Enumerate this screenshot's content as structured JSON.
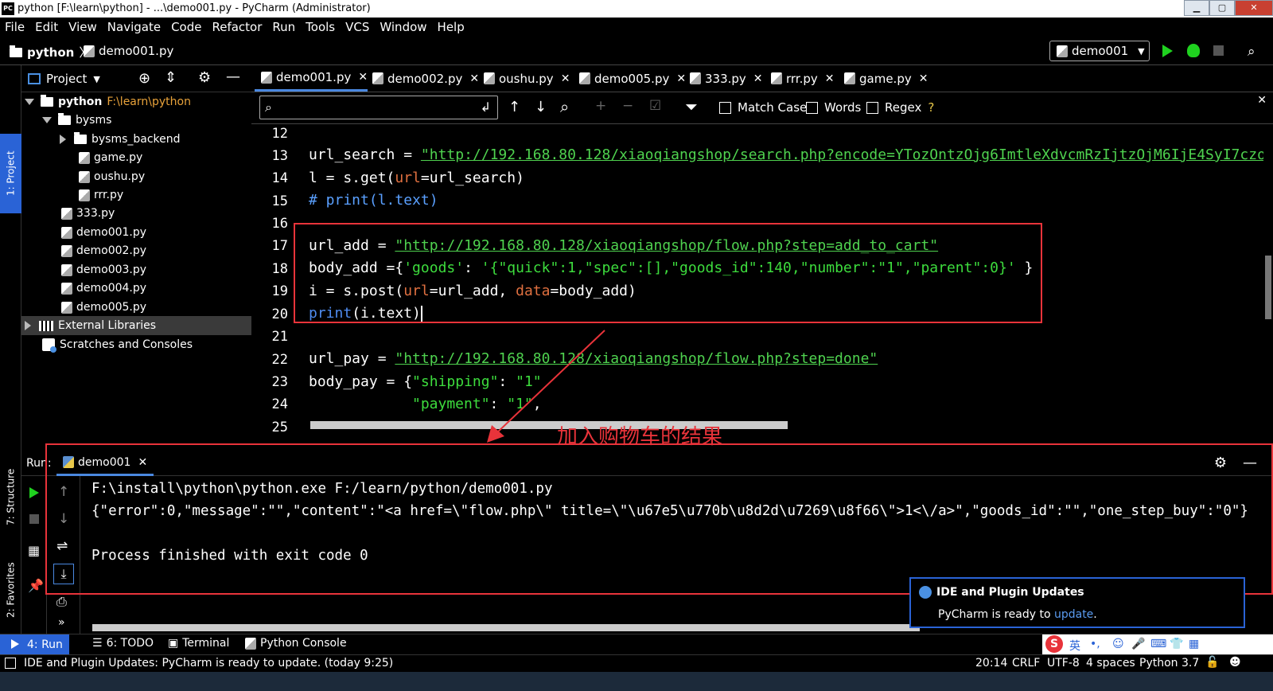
{
  "window": {
    "title": "python [F:\\learn\\python] - ...\\demo001.py - PyCharm (Administrator)",
    "app_icon": "PC"
  },
  "menu": [
    "File",
    "Edit",
    "View",
    "Navigate",
    "Code",
    "Refactor",
    "Run",
    "Tools",
    "VCS",
    "Window",
    "Help"
  ],
  "breadcrumb": {
    "project": "python",
    "file": "demo001.py"
  },
  "run_config": "demo001",
  "project_panel": {
    "title": "Project",
    "root": {
      "name": "python",
      "path": "F:\\learn\\python"
    },
    "items": [
      "bysms",
      "bysms_backend",
      "game.py",
      "oushu.py",
      "rrr.py",
      "333.py",
      "demo001.py",
      "demo002.py",
      "demo003.py",
      "demo004.py",
      "demo005.py"
    ],
    "external": "External Libraries",
    "scratches": "Scratches and Consoles"
  },
  "editor_tabs": [
    "demo001.py",
    "demo002.py",
    "oushu.py",
    "demo005.py",
    "333.py",
    "rrr.py",
    "game.py"
  ],
  "find": {
    "match_case": "Match Case",
    "words": "Words",
    "regex": "Regex",
    "help": "?"
  },
  "code": {
    "line_numbers": [
      "12",
      "13",
      "14",
      "15",
      "16",
      "17",
      "18",
      "19",
      "20",
      "21",
      "22",
      "23",
      "24",
      "25"
    ],
    "l13_var": "url_search",
    "l13_url": "\"http://192.168.80.128/xiaoqiangshop/search.php?encode=YTozOntzOjg6ImtleXdvcmRzIjtzOjM6IjE4SyI7czo",
    "l14_a": "l = s.get(",
    "l14_b": "url",
    "l14_c": "=url_search)",
    "l15": "# print(l.text)",
    "l17_var": "url_add = ",
    "l17_url": "\"http://192.168.80.128/xiaoqiangshop/flow.php?step=add_to_cart\"",
    "l18_a": "body_add ={",
    "l18_b": "'goods'",
    "l18_c": ": ",
    "l18_d": "'{\"quick\":1,\"spec\":[],\"goods_id\":140,\"number\":\"1\",\"parent\":0}'",
    "l18_e": " }",
    "l19_a": "i = s.post(",
    "l19_b": "url",
    "l19_c": "=url_add, ",
    "l19_d": "data",
    "l19_e": "=body_add)",
    "l20_a": "print",
    "l20_b": "(i.text)",
    "l22_var": "url_pay = ",
    "l22_url": "\"http://192.168.80.128/xiaoqiangshop/flow.php?step=done\"",
    "l23_a": "body_pay = {",
    "l23_b": "\"shipping\"",
    "l23_c": ": ",
    "l23_d": "\"1\"",
    "l24_a": "\"payment\"",
    "l24_b": ": ",
    "l24_c": "\"1\"",
    "l24_d": ","
  },
  "annotation": "加入购物车的结果",
  "run_panel": {
    "label": "Run:",
    "tab": "demo001",
    "lines": [
      "F:\\install\\python\\python.exe F:/learn/python/demo001.py",
      "{\"error\":0,\"message\":\"\",\"content\":\"<a href=\\\"flow.php\\\" title=\\\"\\u67e5\\u770b\\u8d2d\\u7269\\u8f66\\\">1<\\/a>\",\"goods_id\":\"\",\"one_step_buy\":\"0\"}",
      "",
      "Process finished with exit code 0"
    ]
  },
  "notification": {
    "title": "IDE and Plugin Updates",
    "text_prefix": "PyCharm is ready to ",
    "link": "update",
    "text_suffix": "."
  },
  "left_tabs": {
    "project": "1: Project",
    "structure": "7: Structure",
    "favorites": "2: Favorites"
  },
  "bottom_tabs": [
    "4: Run",
    "6: TODO",
    "Terminal",
    "Python Console"
  ],
  "status": {
    "message": "IDE and Plugin Updates: PyCharm is ready to update. (today 9:25)",
    "position": "20:14",
    "line_sep": "CRLF",
    "encoding": "UTF-8",
    "indent": "4 spaces",
    "interpreter": "Python 3.7"
  },
  "ime": {
    "lang": "英"
  },
  "colors": {
    "accent": "#2a63d6",
    "highlight_line": "#0d0d78",
    "annotation_red": "#e8333a",
    "string_green": "#3ddc3d"
  }
}
